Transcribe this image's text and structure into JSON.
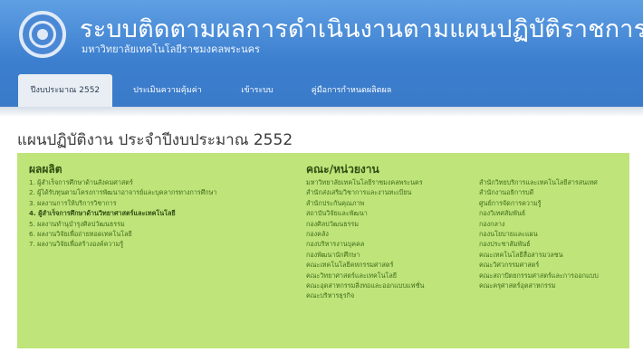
{
  "header": {
    "title": "ระบบติดตามผลการดำเนินงานตามแผนปฏิบัติราชการ",
    "subtitle": "มหาวิทยาลัยเทคโนโลยีราชมงคลพระนคร"
  },
  "nav": {
    "tabs": [
      {
        "label": "ปีงบประมาณ 2552"
      },
      {
        "label": "ประเมินความคุ้มค่า"
      },
      {
        "label": "เข้าระบบ"
      },
      {
        "label": "คู่มือการกำหนดผลิตผล"
      }
    ]
  },
  "main": {
    "page_title": "แผนปฏิบัติงาน ประจำปีงบประมาณ 2552",
    "outputs": {
      "heading": "ผลผลิต",
      "items": [
        "1. ผู้สำเร็จการศึกษาด้านสังคมศาสตร์",
        "2. ผู้ได้รับทุนตามโครงการพัฒนาอาจารย์และบุคลากรทางการศึกษา",
        "3. ผลงานการให้บริการวิชาการ",
        "4. ผู้สำเร็จการศึกษาด้านวิทยาศาสตร์และเทคโนโลยี",
        "5. ผลงานทำนุบำรุงศิลปวัฒนธรรม",
        "6. ผลงานวิจัยเพื่อถ่ายทอดเทคโนโลยี",
        "7. ผลงานวิจัยเพื่อสร้างองค์ความรู้"
      ]
    },
    "units": {
      "heading": "คณะ/หน่วยงาน",
      "col1": [
        "มหาวิทยาลัยเทคโนโลยีราชมงคลพระนคร",
        "สำนักส่งเสริมวิชาการและงานทะเบียน",
        "สำนักประกันคุณภาพ",
        "สถาบันวิจัยและพัฒนา",
        "กองศิลปวัฒนธรรม",
        "กองคลัง",
        "กองบริหารงานบุคคล",
        "กองพัฒนานักศึกษา",
        "คณะเทคโนโลยีคหกรรมศาสตร์",
        "คณะวิทยาศาสตร์และเทคโนโลยี",
        "คณะอุตสาหกรรมสิ่งทอและออกแบบแฟชั่น",
        "คณะบริหารธุรกิจ"
      ],
      "col2": [
        "สำนักวิทยบริการและเทคโนโลยีสารสนเทศ",
        "สำนักงานอธิการบดี",
        "ศูนย์การจัดการความรู้",
        "กองวิเทศสัมพันธ์",
        "กองกลาง",
        "กองนโยบายและแผน",
        "กองประชาสัมพันธ์",
        "คณะเทคโนโลยีสื่อสารมวลชน",
        "คณะวิศวกรรมศาสตร์",
        "คณะสถาปัตยกรรมศาสตร์และการออกแบบ",
        "คณะครุศาสตร์อุตสาหกรรม"
      ]
    }
  },
  "colors": {
    "header_blue": "#3c7fcf",
    "panel_green": "#bfe47a",
    "heading_green": "#2f4d12",
    "link_green": "#3f6d1a"
  }
}
